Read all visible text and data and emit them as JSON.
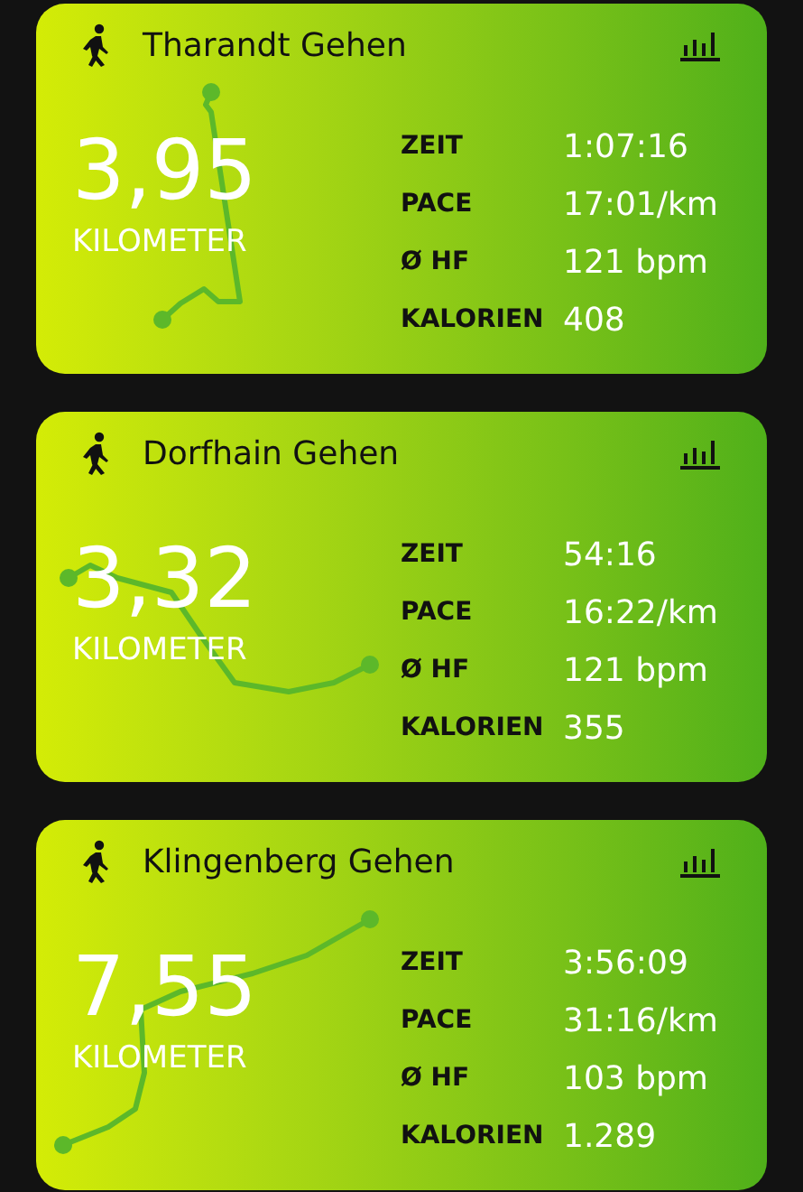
{
  "activities": [
    {
      "title": "Tharandt Gehen",
      "distance": "3,95",
      "unit": "KILOMETER",
      "stats": [
        {
          "label": "ZEIT",
          "value": "1:07:16"
        },
        {
          "label": "PACE",
          "value": "17:01/km"
        },
        {
          "label": "Ø HF",
          "value": "121 bpm"
        },
        {
          "label": "KALORIEN",
          "value": "408"
        }
      ]
    },
    {
      "title": "Dorfhain Gehen",
      "distance": "3,32",
      "unit": "KILOMETER",
      "stats": [
        {
          "label": "ZEIT",
          "value": "54:16"
        },
        {
          "label": "PACE",
          "value": "16:22/km"
        },
        {
          "label": "Ø HF",
          "value": "121 bpm"
        },
        {
          "label": "KALORIEN",
          "value": "355"
        }
      ]
    },
    {
      "title": "Klingenberg Gehen",
      "distance": "7,55",
      "unit": "KILOMETER",
      "stats": [
        {
          "label": "ZEIT",
          "value": "3:56:09"
        },
        {
          "label": "PACE",
          "value": "31:16/km"
        },
        {
          "label": "Ø HF",
          "value": "103 bpm"
        },
        {
          "label": "KALORIEN",
          "value": "1.289"
        }
      ]
    }
  ]
}
